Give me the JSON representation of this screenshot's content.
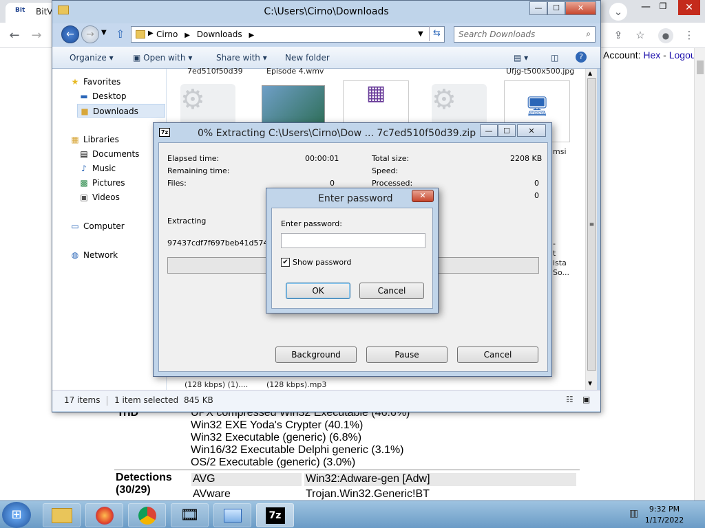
{
  "browser": {
    "tab_title": "BitVie",
    "tab_logo": "Bit",
    "account_label": "Account:",
    "account_name": "Hex",
    "separator": "-",
    "logout": "Logout"
  },
  "page": {
    "file_type_head": "TrID",
    "file_types": [
      "UPX compressed Win32 Executable (46.6%)",
      "Win32 EXE Yoda's Crypter (40.1%)",
      "Win32 Executable (generic) (6.8%)",
      "Win16/32 Executable Delphi generic (3.1%)",
      "OS/2 Executable (generic) (3.0%)"
    ],
    "detections_head": "Detections",
    "detections_count": "(30/29)",
    "detections": [
      {
        "engine": "AVG",
        "result": "Win32:Adware-gen [Adw]"
      },
      {
        "engine": "AVware",
        "result": "Trojan.Win32.Generic!BT"
      }
    ]
  },
  "explorer": {
    "title": "C:\\Users\\Cirno\\Downloads",
    "path": [
      "Cirno",
      "Downloads"
    ],
    "search_placeholder": "Search Downloads",
    "commands": {
      "organize": "Organize",
      "open_with": "Open with",
      "share_with": "Share with",
      "new_folder": "New folder"
    },
    "nav": {
      "favorites": "Favorites",
      "desktop": "Desktop",
      "downloads": "Downloads",
      "libraries": "Libraries",
      "documents": "Documents",
      "music": "Music",
      "pictures": "Pictures",
      "videos": "Videos",
      "computer": "Computer",
      "network": "Network"
    },
    "files_top": [
      "7ed510f50d39",
      "Episode 4.wmv",
      "Ufjg-t500x500.jpg"
    ],
    "files_bottom": [
      "(128 kbps) (1)....",
      "(128 kbps).mp3"
    ],
    "files_right": [
      "msi",
      "-",
      "t",
      "ista",
      "So..."
    ],
    "status": {
      "count": "17 items",
      "selected": "1 item selected",
      "size": "845 KB"
    }
  },
  "zip": {
    "title": "0% Extracting C:\\Users\\Cirno\\Dow ... 7c7ed510f50d39.zip",
    "elapsed_label": "Elapsed time:",
    "elapsed_value": "00:00:01",
    "remaining_label": "Remaining time:",
    "files_label": "Files:",
    "files_value": "0",
    "total_label": "Total size:",
    "total_value": "2208 KB",
    "speed_label": "Speed:",
    "processed_label": "Processed:",
    "processed_value": "0",
    "extra_value": "0",
    "extracting_label": "Extracting",
    "current_file": "97437cdf7f697beb41d574eac",
    "progress": 0,
    "background": "Background",
    "pause": "Pause",
    "cancel": "Cancel"
  },
  "password": {
    "title": "Enter password",
    "label": "Enter password:",
    "value": "",
    "show_label": "Show password",
    "ok": "OK",
    "cancel": "Cancel"
  },
  "taskbar": {
    "time": "9:32 PM",
    "date": "1/17/2022",
    "zip_label": "7z"
  }
}
